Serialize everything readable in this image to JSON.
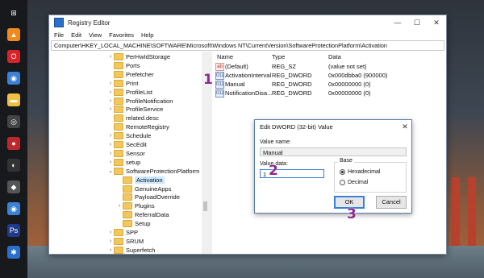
{
  "window": {
    "title": "Registry Editor",
    "menu": [
      "File",
      "Edit",
      "View",
      "Favorites",
      "Help"
    ],
    "address": "Computer\\HKEY_LOCAL_MACHINE\\SOFTWARE\\Microsoft\\Windows NT\\CurrentVersion\\SoftwareProtectionPlatform\\Activation",
    "controls": {
      "minimize": "—",
      "maximize": "☐",
      "close": "✕"
    }
  },
  "taskbar": {
    "icons": [
      {
        "name": "windows-start-icon",
        "glyph": "⊞",
        "color": "#17191d"
      },
      {
        "name": "vlc-icon",
        "glyph": "▲",
        "color": "#f18a1c"
      },
      {
        "name": "opera-icon",
        "glyph": "O",
        "color": "#d8232a"
      },
      {
        "name": "chrome-icon",
        "glyph": "◉",
        "color": "#3b82d6"
      },
      {
        "name": "file-explorer-icon",
        "glyph": "▬",
        "color": "#f0c043"
      },
      {
        "name": "app-ring-icon",
        "glyph": "◎",
        "color": "#444"
      },
      {
        "name": "app-red-icon",
        "glyph": "●",
        "color": "#c0272d"
      },
      {
        "name": "app-dark-icon",
        "glyph": "◐",
        "color": "#333"
      },
      {
        "name": "tag-icon",
        "glyph": "◆",
        "color": "#555"
      },
      {
        "name": "chrome-icon-2",
        "glyph": "◉",
        "color": "#3b82d6"
      },
      {
        "name": "photoshop-icon",
        "glyph": "Ps",
        "color": "#1f3a8a"
      },
      {
        "name": "registry-icon",
        "glyph": "✱",
        "color": "#2a6fc9"
      }
    ]
  },
  "tree": {
    "items": [
      {
        "label": "PerHwIdStorage",
        "chevron": "›",
        "level": 0
      },
      {
        "label": "Ports",
        "chevron": "",
        "level": 0
      },
      {
        "label": "Prefetcher",
        "chevron": "",
        "level": 0
      },
      {
        "label": "Print",
        "chevron": "›",
        "level": 0
      },
      {
        "label": "ProfileList",
        "chevron": "›",
        "level": 0
      },
      {
        "label": "ProfileNotification",
        "chevron": "›",
        "level": 0
      },
      {
        "label": "ProfileService",
        "chevron": "›",
        "level": 0
      },
      {
        "label": "related.desc",
        "chevron": "",
        "level": 0
      },
      {
        "label": "RemoteRegistry",
        "chevron": "",
        "level": 0
      },
      {
        "label": "Schedule",
        "chevron": "›",
        "level": 0
      },
      {
        "label": "SecEdit",
        "chevron": "›",
        "level": 0
      },
      {
        "label": "Sensor",
        "chevron": "›",
        "level": 0
      },
      {
        "label": "setup",
        "chevron": "›",
        "level": 0
      },
      {
        "label": "SoftwareProtectionPlatform",
        "chevron": "⌄",
        "level": 0
      },
      {
        "label": "Activation",
        "chevron": "",
        "level": 1,
        "selected": true
      },
      {
        "label": "GenuineApps",
        "chevron": "",
        "level": 1
      },
      {
        "label": "PayloadOverride",
        "chevron": "",
        "level": 1
      },
      {
        "label": "Plugins",
        "chevron": "›",
        "level": 1
      },
      {
        "label": "ReferralData",
        "chevron": "",
        "level": 1
      },
      {
        "label": "Setup",
        "chevron": "",
        "level": 1
      },
      {
        "label": "SPP",
        "chevron": "›",
        "level": 0
      },
      {
        "label": "SRUM",
        "chevron": "›",
        "level": 0
      },
      {
        "label": "Superfetch",
        "chevron": "›",
        "level": 0
      }
    ]
  },
  "values": {
    "headers": {
      "name": "Name",
      "type": "Type",
      "data": "Data"
    },
    "rows": [
      {
        "name": "(Default)",
        "type": "REG_SZ",
        "data": "(value not set)",
        "icon": "ab"
      },
      {
        "name": "ActivationInterval",
        "type": "REG_DWORD",
        "data": "0x000dbba0 (900000)",
        "icon": "011"
      },
      {
        "name": "Manual",
        "type": "REG_DWORD",
        "data": "0x00000000 (0)",
        "icon": "011"
      },
      {
        "name": "NotificationDisa...",
        "type": "REG_DWORD",
        "data": "0x00000000 (0)",
        "icon": "011"
      }
    ]
  },
  "dialog": {
    "title": "Edit DWORD (32-bit) Value",
    "close": "✕",
    "value_name_label": "Value name:",
    "value_name": "Manual",
    "value_data_label": "Value data:",
    "value_data": "1",
    "base_label": "Base",
    "base_options": [
      {
        "label": "Hexadecimal",
        "selected": true
      },
      {
        "label": "Decimal",
        "selected": false
      }
    ],
    "ok": "OK",
    "cancel": "Cancel"
  },
  "steps": [
    "1",
    "2",
    "3"
  ]
}
